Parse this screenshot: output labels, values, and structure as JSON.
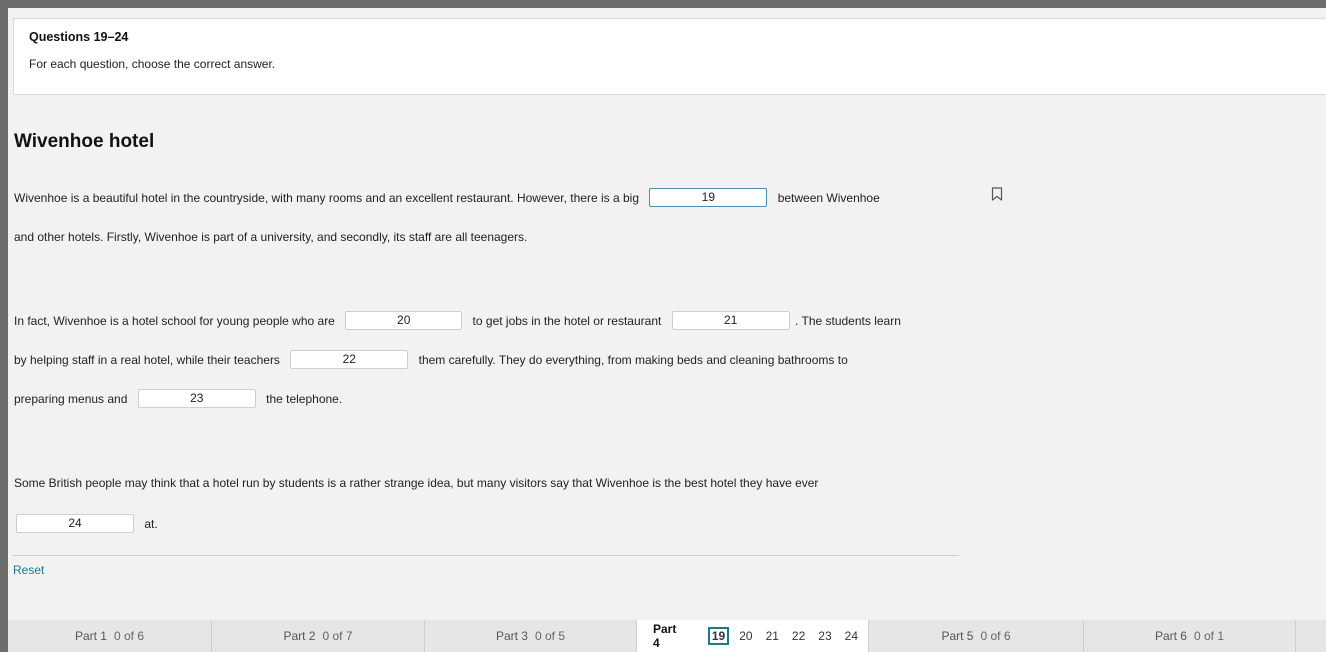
{
  "instructions": {
    "heading": "Questions 19–24",
    "text": "For each question, choose the correct answer."
  },
  "title": "Wivenhoe hotel",
  "passage": {
    "p1_line1_a": "Wivenhoe is a beautiful hotel in the countryside, with many rooms and an excellent restaurant. However, there is a big",
    "gap19": "19",
    "p1_line1_b": "between Wivenhoe",
    "p1_line2": "and other hotels. Firstly, Wivenhoe is part of a university, and secondly, its staff are all teenagers.",
    "p2_line1_a": "In fact, Wivenhoe is a hotel school for young people who are",
    "gap20": "20",
    "p2_line1_b": "to get jobs in the hotel or restaurant",
    "gap21": "21",
    "p2_line1_c": ". The students learn",
    "p2_line2_a": "by helping staff in a real hotel, while their teachers",
    "gap22": "22",
    "p2_line2_b": "them carefully. They do everything, from making beds and cleaning bathrooms to",
    "p2_line3_a": "preparing menus and",
    "gap23": "23",
    "p2_line3_b": "the telephone.",
    "p3_line1": "Some British people may think that a hotel run by students is a rather strange idea, but many visitors say that Wivenhoe is the best hotel they have ever",
    "gap24": "24",
    "p3_line2_b": "at."
  },
  "reset_label": "Reset",
  "icons": {
    "bookmark": "bookmark-icon"
  },
  "colors": {
    "accent": "#1b7a8a",
    "gap_active_border": "#4a8fb8"
  },
  "nav": {
    "parts": [
      {
        "name": "Part 1",
        "count": "0 of 6"
      },
      {
        "name": "Part 2",
        "count": "0 of 7"
      },
      {
        "name": "Part 3",
        "count": "0 of 5"
      },
      {
        "name": "Part 4",
        "questions": [
          "19",
          "20",
          "21",
          "22",
          "23",
          "24"
        ],
        "current": "19"
      },
      {
        "name": "Part 5",
        "count": "0 of 6"
      },
      {
        "name": "Part 6",
        "count": "0 of 1"
      }
    ]
  }
}
